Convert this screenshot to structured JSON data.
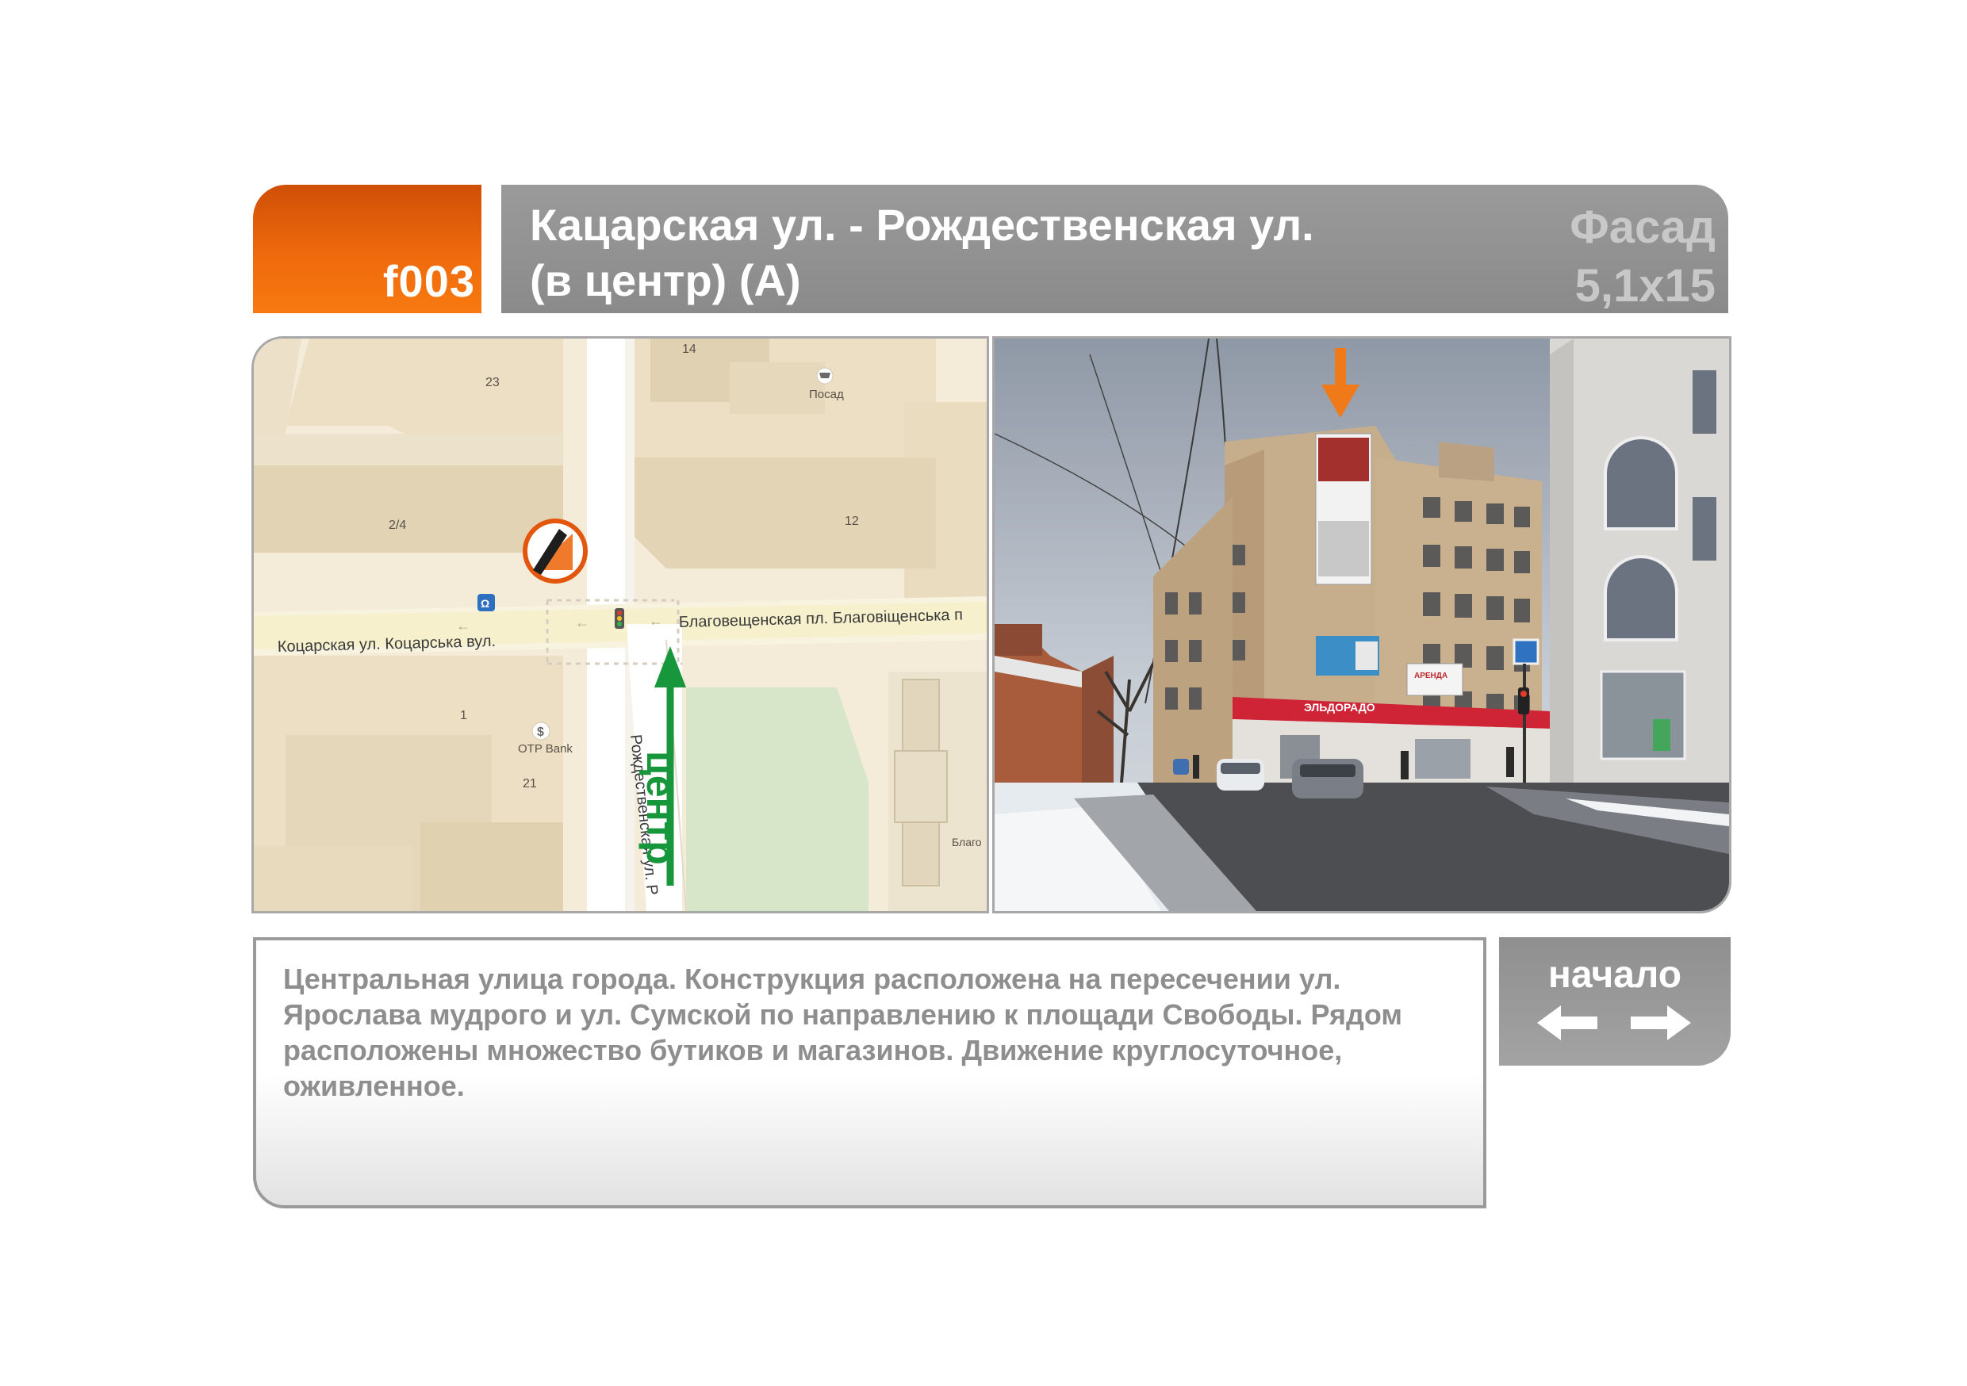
{
  "header": {
    "code": "f003",
    "title_line1": "Кацарская ул. - Рождественская ул.",
    "title_line2": "(в центр)  (А)",
    "surface_type": "Фасад",
    "size": "5,1х15"
  },
  "map": {
    "labels": {
      "house_23": "23",
      "house_14": "14",
      "posad": "Посад",
      "house_2_4": "2/4",
      "house_12": "12",
      "street_kotsarska": "Коцарская ул. Коцарська вул.",
      "street_blagoveshch": "Благовещенская пл. Благовіщенська п",
      "house_1": "1",
      "otp_bank": "OTP Bank",
      "house_21": "21",
      "street_rozhdestv": "Рождественская ул. Р",
      "direction": "центр",
      "blago_cut": "Благо"
    },
    "icons": [
      "billboard-marker-icon",
      "tram-stop-icon",
      "traffic-light-icon",
      "bank-icon",
      "shop-icon"
    ]
  },
  "photo": {
    "signs": {
      "eldorado": "ЭЛЬДОРАДО",
      "rent": "АРЕНДА",
      "ad": "Эльдорадо"
    }
  },
  "description": {
    "text": "Центральная улица города. Конструкция расположена на пересечении ул. Ярослава мудрого и ул. Сумской по направлению к площади Свободы. Рядом расположены множество бутиков и магазинов.  Движение круглосуточное, оживленное."
  },
  "nav": {
    "label": "начало"
  },
  "colors": {
    "accent_orange": "#ef6a0d",
    "header_grey": "#8f8f8f",
    "direction_green": "#17963c",
    "text_grey": "#8e8e8e"
  }
}
